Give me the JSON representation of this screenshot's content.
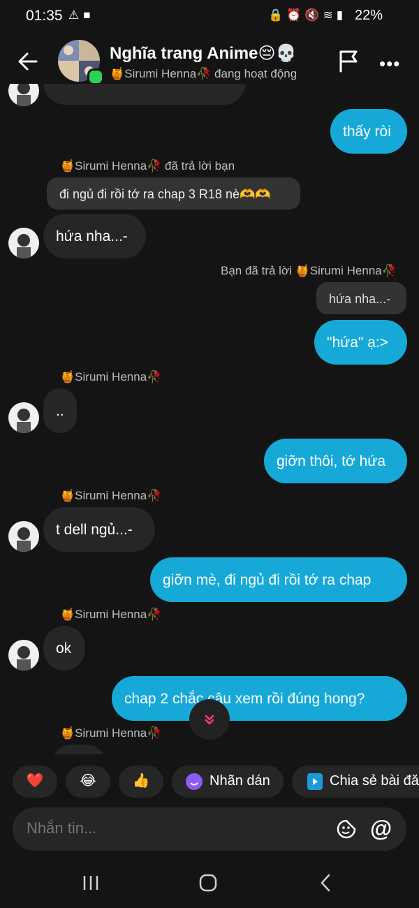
{
  "status_bar": {
    "time": "01:35",
    "battery": "22%"
  },
  "header": {
    "title": "Nghĩa trang Anime😔💀",
    "subtitle": "🍯Sirumi Henna🥀 đang hoạt động"
  },
  "messages": {
    "m1": "thấy ròi",
    "reply1_label": "🍯Sirumi Henna🥀 đã trả lời bạn",
    "reply1_quote": "đi ngủ đi rồi tớ ra chap 3 R18 nè🫶🫶",
    "m2": "hứa nha...-",
    "reply2_label": "Bạn đã trả lời 🍯Sirumi Henna🥀",
    "reply2_quote": "hứa nha...-",
    "m3": "\"hứa\" ạ:>",
    "sender_a": "🍯Sirumi Henna🥀",
    "m4": "..",
    "m5": "giỡn thôi, tớ hứa",
    "sender_b": "🍯Sirumi Henna🥀",
    "m6": "t dell ngủ...-",
    "m7": "giỡn mè, đi ngủ đi rồi tớ ra chap",
    "sender_c": "🍯Sirumi Henna🥀",
    "m8": "ok",
    "m9": "chap 2 chắc cậu xem rồi đúng hong?",
    "sender_d": "🍯Sirumi Henna🥀"
  },
  "quick_actions": {
    "heart": "❤️",
    "laugh": "😂",
    "thumb": "👍",
    "sticker_label": "Nhãn dán",
    "share_label": "Chia sẻ bài đă"
  },
  "composer": {
    "placeholder": "Nhắn tin..."
  },
  "colors": {
    "outgoing": "#16a9d8",
    "incoming": "#262626",
    "background": "#141414",
    "online": "#2bd155"
  }
}
